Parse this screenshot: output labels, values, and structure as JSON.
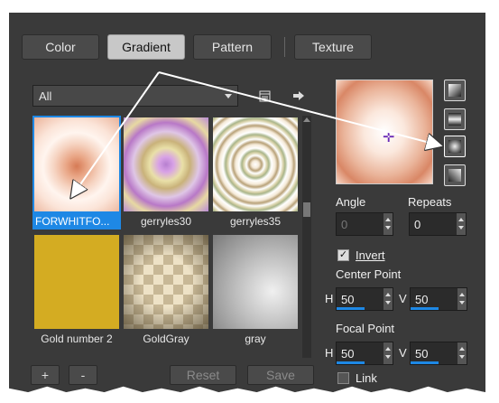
{
  "tabs": [
    {
      "label": "Color"
    },
    {
      "label": "Gradient",
      "active": true
    },
    {
      "label": "Pattern"
    },
    {
      "label": "Texture"
    }
  ],
  "filter": {
    "selected": "All"
  },
  "gradients": [
    {
      "label": "FORWHITFO...",
      "selected": true
    },
    {
      "label": "gerryles30"
    },
    {
      "label": "gerryles35"
    },
    {
      "label": "Gold number 2"
    },
    {
      "label": "GoldGray"
    },
    {
      "label": "gray"
    }
  ],
  "buttons": {
    "add": "+",
    "remove": "-",
    "reset": "Reset",
    "save": "Save"
  },
  "settings": {
    "angle_label": "Angle",
    "angle_value": "0",
    "repeats_label": "Repeats",
    "repeats_value": "0",
    "invert_label": "Invert",
    "invert_checked": true,
    "center_label": "Center Point",
    "center_h_prefix": "H",
    "center_h": "50",
    "center_v_prefix": "V",
    "center_v": "50",
    "focal_label": "Focal Point",
    "focal_h_prefix": "H",
    "focal_h": "50",
    "focal_v_prefix": "V",
    "focal_v": "50",
    "link_label": "Link"
  },
  "icons": {
    "dropdown_arrow": "chevron-down-icon",
    "editor": "gradient-editor-icon",
    "apply": "arrow-right-icon",
    "focal_marker": "crosshair-icon"
  },
  "colors": {
    "accent": "#1e88e5",
    "panel": "#3a3a3a",
    "annotation": "#ffffff"
  }
}
